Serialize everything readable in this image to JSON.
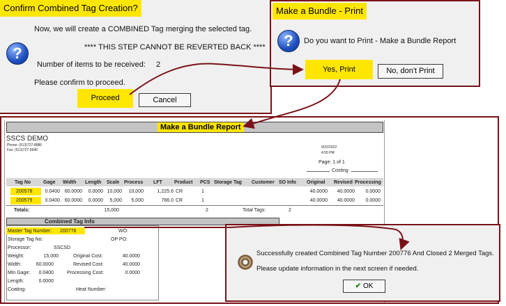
{
  "confirm_dialog": {
    "title": "Confirm Combined Tag Creation?",
    "line1": "Now, we will create a COMBINED Tag merging the selected tag.",
    "line2": "**** THIS STEP CANNOT BE REVERTED BACK ****",
    "items_label": "Number of items to be received:",
    "items_value": "2",
    "line4": "Please confirm to proceed.",
    "proceed": "Proceed",
    "cancel": "Cancel"
  },
  "print_dialog": {
    "title": "Make a Bundle - Print",
    "message": "Do you want to Print - Make a Bundle Report",
    "yes": "Yes, Print",
    "no": "No, don't Print"
  },
  "report": {
    "title": "Make a Bundle Report",
    "company": "SSCS DEMO",
    "phone": "Phone:    (513)727-8886",
    "fax": "Fax:       (513)727-9940",
    "date": "9/22/2022",
    "time": "4:55 PM",
    "page": "Page: 1 of 1",
    "costing": "Costing",
    "columns": [
      "Tag No",
      "Gage",
      "Width",
      "Length",
      "Scale",
      "Process",
      "LFT",
      "Product",
      "PCS",
      "Storage Tag",
      "Customer",
      "SO Info",
      "Original",
      "Revised",
      "Processing"
    ],
    "rows": [
      [
        "200578",
        "0.0400",
        "60.0000",
        "0.0000",
        "10,000",
        "10,000",
        "1,225.6",
        "CR",
        "1",
        "",
        "",
        "",
        "40.0000",
        "40.0000",
        "0.0000"
      ],
      [
        "200579",
        "0.0400",
        "60.0000",
        "0.0000",
        "5,000",
        "5,000",
        "766.0",
        "CR",
        "1",
        "",
        "",
        "",
        "40.0000",
        "40.0000",
        "0.0000"
      ]
    ],
    "totals_label": "Totals:",
    "totals_scale": "15,000",
    "totals_pcs": "2",
    "total_tags_label": "Total Tags:",
    "total_tags_value": "2",
    "combined_header": "Combined Tag Info",
    "master_tag_label": "Master Tag Number:",
    "master_tag_value": "200776",
    "wo_label": "WO:",
    "storage_tag_label": "Storage Tag No:",
    "op_po_label": "OP PO:",
    "processor_label": "Processor:",
    "processor_value": "SSCSD",
    "weight_label": "Weight:",
    "weight_value": "15,000",
    "orig_cost_label": "Original Cost:",
    "orig_cost_value": "40.0000",
    "width_label": "Width:",
    "width_value": "60.0000",
    "rev_cost_label": "Revised Cost:",
    "rev_cost_value": "40.0000",
    "min_gage_label": "Min Gage:",
    "min_gage_value": "0.0400",
    "proc_cost_label": "Processing Cost:",
    "proc_cost_value": "0.0000",
    "length_label": "Length:",
    "length_value": "0.0000",
    "coating_label": "Coating:",
    "heat_label": "Heat Number:"
  },
  "success_dialog": {
    "message": "Successfully created Combined Tag Number 200776 And Closed 2 Merged Tags.",
    "message2": "Please update information in the next screen if needed.",
    "ok": "OK"
  },
  "colors": {
    "frame": "#7a1118",
    "highlight": "#ffe600"
  }
}
